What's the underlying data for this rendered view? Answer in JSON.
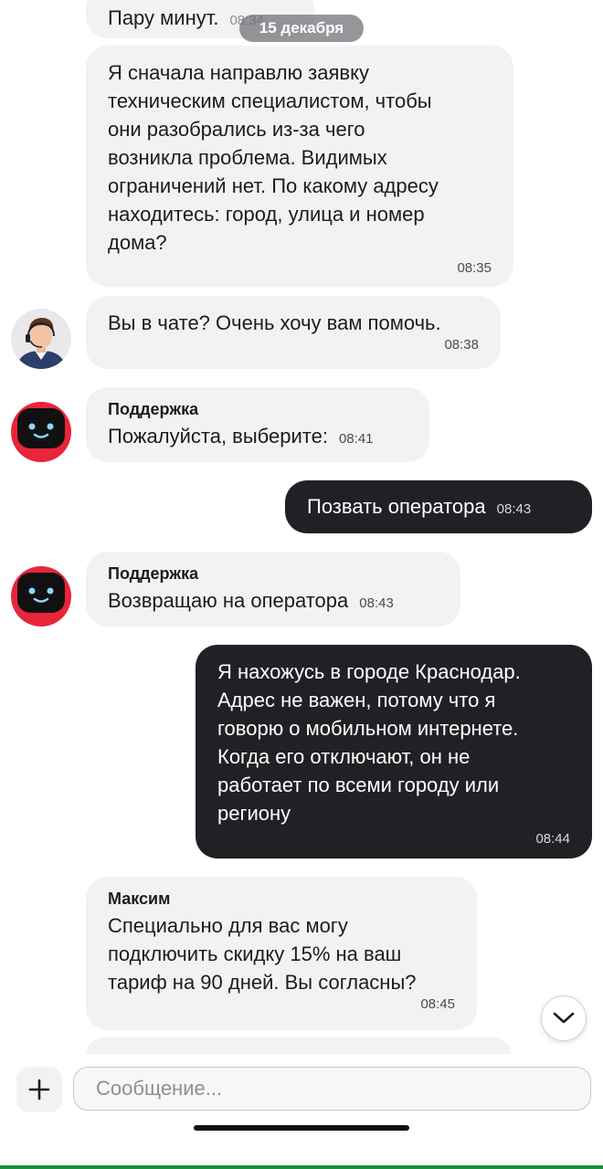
{
  "chat": {
    "date_label": "15 декабря",
    "messages": [
      {
        "text": "Пару минут.",
        "time": "08:34"
      },
      {
        "text": "Я сначала направлю заявку\nтехническим специалистом, чтобы\nони разобрались из-за чего\nвозникла проблема. Видимых\nограничений нет. По какому адресу\nнаходитесь: город, улица и номер\nдома?",
        "time": "08:35"
      },
      {
        "text": "Вы в чате? Очень хочу вам помочь.",
        "time": "08:38"
      },
      {
        "sender": "Поддержка",
        "text": "Пожалуйста, выберите:",
        "time": "08:41"
      },
      {
        "text": "Позвать оператора",
        "time": "08:43"
      },
      {
        "sender": "Поддержка",
        "text": "Возвращаю на оператора",
        "time": "08:43"
      },
      {
        "text": "Я нахожусь в городе Краснодар.\nАдрес не важен, потому что я\nговорю о мобильном интернете.\nКогда его отключают, он не\nработает по всеми городу или\nрегиону",
        "time": "08:44"
      },
      {
        "sender": "Максим",
        "text": "Специально для вас могу\nподключить скидку 15% на ваш\nтариф на 90 дней. Вы согласны?",
        "time": "08:45"
      }
    ]
  },
  "composer": {
    "placeholder": "Сообщение..."
  },
  "icons": {
    "attach": "plus-icon",
    "scroll": "chevron-down-icon",
    "operator_avatar": "operator-avatar",
    "bot_avatar": "robot-icon"
  },
  "colors": {
    "incoming_bubble": "#f2f2f5",
    "outgoing_bubble": "#202124",
    "bot_red": "#e8253a"
  }
}
